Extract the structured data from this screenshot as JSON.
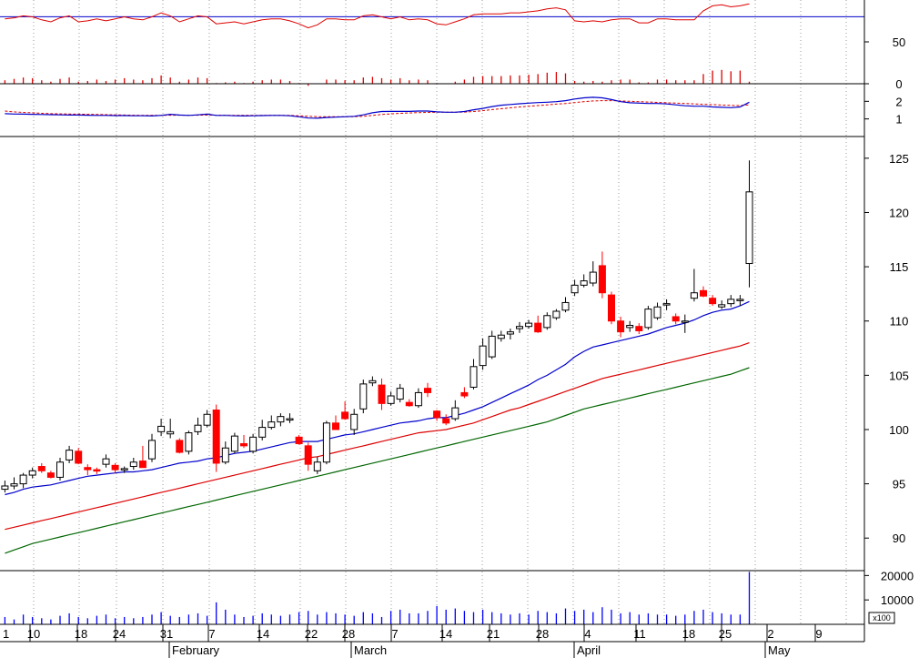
{
  "chart_data": {
    "type": "candlestick",
    "colors": {
      "background": "#ffffff",
      "up_candle_fill": "#ffffff",
      "down_candle_fill": "#ff0000",
      "candle_outline": "#000000",
      "ma_short": "#0000cc",
      "ma_mid": "#dd0000",
      "ma_long": "#006600",
      "volume": "#0000ff",
      "rsi": "#dd0000",
      "rsi_hist": "#dd0000",
      "macd": "#0000cc",
      "signal": "#dd0000",
      "grid": "#999999",
      "frame": "#000000"
    },
    "x_axis": {
      "day_labels": [
        "1",
        "10",
        "18",
        "24",
        "31",
        "7",
        "14",
        "22",
        "28",
        "7",
        "14",
        "21",
        "28",
        "4",
        "11",
        "18",
        "25",
        "2",
        "9"
      ],
      "month_labels": [
        "February",
        "March",
        "April",
        "May"
      ]
    },
    "price_panel": {
      "ylim": [
        87,
        127
      ],
      "yticks": [
        90,
        95,
        100,
        105,
        110,
        115,
        120,
        125
      ],
      "candles": [
        [
          94.5,
          95.3,
          94.2,
          94.8
        ],
        [
          94.8,
          95.6,
          94.5,
          95.0
        ],
        [
          95.0,
          96.0,
          94.6,
          95.8
        ],
        [
          95.8,
          96.5,
          95.5,
          96.2
        ],
        [
          96.6,
          96.9,
          96.0,
          96.2
        ],
        [
          96.0,
          96.2,
          95.5,
          95.6
        ],
        [
          95.6,
          97.4,
          95.3,
          97.0
        ],
        [
          97.2,
          98.5,
          96.9,
          98.1
        ],
        [
          98.0,
          98.3,
          96.8,
          96.9
        ],
        [
          96.5,
          96.8,
          95.8,
          96.3
        ],
        [
          96.3,
          96.5,
          95.9,
          96.2
        ],
        [
          96.8,
          97.7,
          96.5,
          97.3
        ],
        [
          96.7,
          96.9,
          96.0,
          96.3
        ],
        [
          96.3,
          96.6,
          96.0,
          96.4
        ],
        [
          96.6,
          97.4,
          96.3,
          97.0
        ],
        [
          97.1,
          98.5,
          96.6,
          96.5
        ],
        [
          97.3,
          99.6,
          97.0,
          99.0
        ],
        [
          99.8,
          101.0,
          99.4,
          100.3
        ],
        [
          99.6,
          101.0,
          99.2,
          99.8
        ],
        [
          99.0,
          99.2,
          97.8,
          97.9
        ],
        [
          98.0,
          99.9,
          97.7,
          99.7
        ],
        [
          99.8,
          101.1,
          99.5,
          100.4
        ],
        [
          100.4,
          101.8,
          100.2,
          101.4
        ],
        [
          101.8,
          102.3,
          96.1,
          96.9
        ],
        [
          97.0,
          98.9,
          96.8,
          98.3
        ],
        [
          98.0,
          99.7,
          97.8,
          99.4
        ],
        [
          98.7,
          99.5,
          98.3,
          98.5
        ],
        [
          98.0,
          99.6,
          97.8,
          99.3
        ],
        [
          99.3,
          100.9,
          99.0,
          100.2
        ],
        [
          100.2,
          101.3,
          100.0,
          100.7
        ],
        [
          100.7,
          101.5,
          100.3,
          101.2
        ],
        [
          101.0,
          101.5,
          100.6,
          101.0
        ],
        [
          99.3,
          99.5,
          98.6,
          98.7
        ],
        [
          98.5,
          98.8,
          96.2,
          96.8
        ],
        [
          96.2,
          97.5,
          95.9,
          97.0
        ],
        [
          97.0,
          100.8,
          96.8,
          100.6
        ],
        [
          100.6,
          101.3,
          100.0,
          100.0
        ],
        [
          101.6,
          102.6,
          100.9,
          101.0
        ],
        [
          100.0,
          101.9,
          99.5,
          101.4
        ],
        [
          101.9,
          104.6,
          101.5,
          104.2
        ],
        [
          104.3,
          104.9,
          104.0,
          104.5
        ],
        [
          104.1,
          104.7,
          101.8,
          102.4
        ],
        [
          102.4,
          103.5,
          102.2,
          103.1
        ],
        [
          102.8,
          104.2,
          102.5,
          103.8
        ],
        [
          102.5,
          102.8,
          102.1,
          102.2
        ],
        [
          102.2,
          103.8,
          102.0,
          103.4
        ],
        [
          103.8,
          104.3,
          103.0,
          103.4
        ],
        [
          101.7,
          101.8,
          100.8,
          101.1
        ],
        [
          101.0,
          101.4,
          100.4,
          100.6
        ],
        [
          101.0,
          102.7,
          100.8,
          102.0
        ],
        [
          103.4,
          103.9,
          102.9,
          103.1
        ],
        [
          103.9,
          106.5,
          103.7,
          105.8
        ],
        [
          105.9,
          108.4,
          105.5,
          107.7
        ],
        [
          106.7,
          109.1,
          106.5,
          108.6
        ],
        [
          108.4,
          109.1,
          108.1,
          108.7
        ],
        [
          108.8,
          109.3,
          108.3,
          109.0
        ],
        [
          109.3,
          109.9,
          108.9,
          109.5
        ],
        [
          109.5,
          110.1,
          109.3,
          109.8
        ],
        [
          109.8,
          110.5,
          108.9,
          109.0
        ],
        [
          109.4,
          110.8,
          109.2,
          110.5
        ],
        [
          110.3,
          111.1,
          110.1,
          110.9
        ],
        [
          111.0,
          112.2,
          110.8,
          111.7
        ],
        [
          112.6,
          113.8,
          112.3,
          113.3
        ],
        [
          113.3,
          114.3,
          113.1,
          113.7
        ],
        [
          113.5,
          115.5,
          113.2,
          114.5
        ],
        [
          115.1,
          116.4,
          112.1,
          112.6
        ],
        [
          112.4,
          112.7,
          109.7,
          110.0
        ],
        [
          110.0,
          110.4,
          108.5,
          109.0
        ],
        [
          109.4,
          110.0,
          109.0,
          109.6
        ],
        [
          109.5,
          109.8,
          108.8,
          109.1
        ],
        [
          109.4,
          111.4,
          109.2,
          111.1
        ],
        [
          110.3,
          111.7,
          110.1,
          111.3
        ],
        [
          111.5,
          112.0,
          111.0,
          111.6
        ],
        [
          110.4,
          110.7,
          109.7,
          110.0
        ],
        [
          110.0,
          110.6,
          108.9,
          110.0
        ],
        [
          112.1,
          114.8,
          111.8,
          112.6
        ],
        [
          112.8,
          113.2,
          112.2,
          112.3
        ],
        [
          112.1,
          112.4,
          111.4,
          111.6
        ],
        [
          111.3,
          111.9,
          111.1,
          111.5
        ],
        [
          111.6,
          112.4,
          111.3,
          112.0
        ],
        [
          111.9,
          112.4,
          111.4,
          112.0
        ],
        [
          115.3,
          124.8,
          113.1,
          121.9
        ]
      ],
      "ma_short": [
        94.0,
        94.2,
        94.5,
        94.7,
        94.8,
        94.9,
        95.1,
        95.3,
        95.5,
        95.7,
        95.8,
        95.9,
        96.0,
        96.1,
        96.1,
        96.2,
        96.3,
        96.5,
        96.7,
        96.9,
        97.0,
        97.1,
        97.3,
        97.4,
        97.6,
        97.8,
        97.9,
        98.0,
        98.2,
        98.4,
        98.6,
        98.8,
        98.9,
        98.9,
        98.9,
        99.1,
        99.3,
        99.5,
        99.6,
        99.8,
        100.0,
        100.2,
        100.4,
        100.6,
        100.7,
        100.8,
        101.0,
        101.1,
        101.1,
        101.3,
        101.5,
        101.8,
        102.1,
        102.5,
        102.9,
        103.3,
        103.7,
        104.1,
        104.6,
        105.0,
        105.5,
        106.0,
        106.7,
        107.2,
        107.6,
        107.8,
        108.0,
        108.2,
        108.4,
        108.6,
        108.8,
        109.1,
        109.4,
        109.6,
        109.8,
        110.1,
        110.5,
        110.8,
        111.0,
        111.1,
        111.4,
        111.8
      ],
      "ma_mid": [
        90.8,
        91.0,
        91.2,
        91.4,
        91.6,
        91.8,
        92.0,
        92.2,
        92.4,
        92.6,
        92.8,
        93.0,
        93.2,
        93.4,
        93.6,
        93.8,
        94.0,
        94.2,
        94.4,
        94.6,
        94.8,
        95.0,
        95.2,
        95.4,
        95.6,
        95.8,
        96.0,
        96.2,
        96.4,
        96.6,
        96.8,
        97.0,
        97.2,
        97.4,
        97.5,
        97.7,
        97.9,
        98.1,
        98.3,
        98.5,
        98.7,
        98.9,
        99.1,
        99.3,
        99.5,
        99.7,
        99.8,
        99.9,
        100.0,
        100.2,
        100.4,
        100.6,
        100.9,
        101.2,
        101.5,
        101.8,
        102.0,
        102.3,
        102.6,
        102.9,
        103.2,
        103.5,
        103.8,
        104.1,
        104.4,
        104.7,
        104.9,
        105.1,
        105.3,
        105.5,
        105.7,
        105.9,
        106.1,
        106.3,
        106.5,
        106.7,
        106.9,
        107.1,
        107.3,
        107.5,
        107.7,
        108.0
      ],
      "ma_long": [
        88.6,
        88.9,
        89.2,
        89.5,
        89.7,
        89.9,
        90.1,
        90.3,
        90.5,
        90.7,
        90.9,
        91.1,
        91.3,
        91.5,
        91.7,
        91.9,
        92.1,
        92.3,
        92.5,
        92.7,
        92.9,
        93.1,
        93.3,
        93.5,
        93.7,
        93.9,
        94.1,
        94.3,
        94.5,
        94.7,
        94.9,
        95.1,
        95.3,
        95.5,
        95.7,
        95.9,
        96.1,
        96.3,
        96.5,
        96.7,
        96.9,
        97.1,
        97.3,
        97.5,
        97.7,
        97.9,
        98.1,
        98.3,
        98.5,
        98.7,
        98.9,
        99.1,
        99.3,
        99.5,
        99.7,
        99.9,
        100.1,
        100.3,
        100.5,
        100.7,
        101.0,
        101.3,
        101.6,
        101.9,
        102.1,
        102.3,
        102.5,
        102.7,
        102.9,
        103.1,
        103.3,
        103.5,
        103.7,
        103.9,
        104.1,
        104.3,
        104.5,
        104.7,
        104.9,
        105.1,
        105.4,
        105.7
      ]
    },
    "rsi_panel": {
      "ylim": [
        0,
        100
      ],
      "yticks": [
        0,
        50
      ],
      "reference_level": 80,
      "rsi": [
        66,
        68,
        72,
        70,
        64,
        60,
        68,
        72,
        60,
        62,
        66,
        62,
        66,
        70,
        66,
        64,
        70,
        78,
        72,
        60,
        66,
        72,
        70,
        56,
        58,
        60,
        56,
        60,
        64,
        66,
        66,
        62,
        56,
        48,
        54,
        66,
        66,
        64,
        64,
        72,
        74,
        70,
        66,
        70,
        64,
        66,
        64,
        56,
        54,
        60,
        66,
        74,
        76,
        76,
        76,
        78,
        78,
        80,
        82,
        86,
        88,
        84,
        62,
        60,
        62,
        60,
        64,
        66,
        66,
        58,
        58,
        66,
        66,
        64,
        64,
        64,
        82,
        92,
        94,
        90,
        92,
        96
      ],
      "hist": [
        10,
        14,
        18,
        16,
        10,
        6,
        14,
        18,
        6,
        8,
        12,
        8,
        12,
        16,
        12,
        10,
        16,
        24,
        18,
        6,
        12,
        18,
        16,
        2,
        4,
        6,
        2,
        6,
        10,
        12,
        12,
        8,
        2,
        -6,
        0,
        12,
        12,
        10,
        10,
        18,
        20,
        16,
        12,
        16,
        10,
        12,
        10,
        2,
        0,
        6,
        12,
        20,
        22,
        22,
        22,
        24,
        24,
        26,
        28,
        32,
        34,
        30,
        8,
        6,
        8,
        6,
        10,
        12,
        12,
        4,
        4,
        12,
        12,
        10,
        10,
        10,
        28,
        38,
        40,
        36,
        38,
        6
      ]
    },
    "macd_panel": {
      "ylim": [
        0,
        3
      ],
      "yticks": [
        1,
        2
      ],
      "macd": [
        1.3,
        1.28,
        1.27,
        1.26,
        1.25,
        1.24,
        1.23,
        1.22,
        1.22,
        1.21,
        1.2,
        1.2,
        1.19,
        1.19,
        1.18,
        1.18,
        1.17,
        1.2,
        1.26,
        1.22,
        1.2,
        1.23,
        1.27,
        1.2,
        1.2,
        1.18,
        1.17,
        1.18,
        1.19,
        1.2,
        1.2,
        1.18,
        1.12,
        1.05,
        1.04,
        1.08,
        1.1,
        1.12,
        1.15,
        1.23,
        1.35,
        1.42,
        1.43,
        1.43,
        1.43,
        1.45,
        1.45,
        1.4,
        1.38,
        1.38,
        1.42,
        1.52,
        1.6,
        1.7,
        1.78,
        1.82,
        1.86,
        1.9,
        1.93,
        1.95,
        1.98,
        2.04,
        2.13,
        2.2,
        2.23,
        2.2,
        2.1,
        1.98,
        1.92,
        1.9,
        1.88,
        1.88,
        1.85,
        1.8,
        1.75,
        1.72,
        1.72,
        1.68,
        1.66,
        1.64,
        1.68,
        1.95
      ],
      "signal": [
        1.45,
        1.4,
        1.37,
        1.35,
        1.32,
        1.3,
        1.29,
        1.28,
        1.27,
        1.26,
        1.25,
        1.24,
        1.23,
        1.22,
        1.21,
        1.2,
        1.2,
        1.2,
        1.21,
        1.21,
        1.21,
        1.21,
        1.22,
        1.21,
        1.21,
        1.2,
        1.2,
        1.2,
        1.2,
        1.2,
        1.2,
        1.2,
        1.18,
        1.15,
        1.13,
        1.12,
        1.12,
        1.12,
        1.13,
        1.15,
        1.2,
        1.25,
        1.29,
        1.32,
        1.34,
        1.36,
        1.37,
        1.38,
        1.38,
        1.38,
        1.39,
        1.42,
        1.47,
        1.53,
        1.58,
        1.63,
        1.68,
        1.72,
        1.76,
        1.8,
        1.84,
        1.88,
        1.93,
        1.98,
        2.02,
        2.04,
        2.04,
        2.02,
        2.0,
        1.98,
        1.96,
        1.94,
        1.92,
        1.9,
        1.88,
        1.85,
        1.83,
        1.81,
        1.79,
        1.77,
        1.76,
        1.8
      ]
    },
    "volume_panel": {
      "ylim": [
        0,
        22000
      ],
      "yticks": [
        10000,
        20000
      ],
      "unit_label": "x100",
      "volume": [
        3000,
        2000,
        4000,
        3000,
        2500,
        2000,
        3500,
        4500,
        3000,
        2500,
        3500,
        4000,
        2500,
        3000,
        2500,
        3000,
        4000,
        5000,
        3500,
        3000,
        4000,
        4500,
        3500,
        9000,
        6000,
        4000,
        3000,
        3500,
        4500,
        4000,
        3500,
        4000,
        5000,
        5500,
        4000,
        5000,
        4500,
        4000,
        3500,
        5000,
        4500,
        3000,
        5500,
        6000,
        4500,
        4500,
        5500,
        7500,
        6000,
        6500,
        5500,
        5000,
        6000,
        5000,
        4500,
        4000,
        4500,
        4000,
        5500,
        5000,
        4500,
        6500,
        5500,
        6000,
        5000,
        7000,
        6000,
        4500,
        5000,
        4000,
        4500,
        4000,
        4000,
        3500,
        4000,
        5500,
        6000,
        5000,
        4500,
        4000,
        4000,
        21500
      ]
    }
  }
}
